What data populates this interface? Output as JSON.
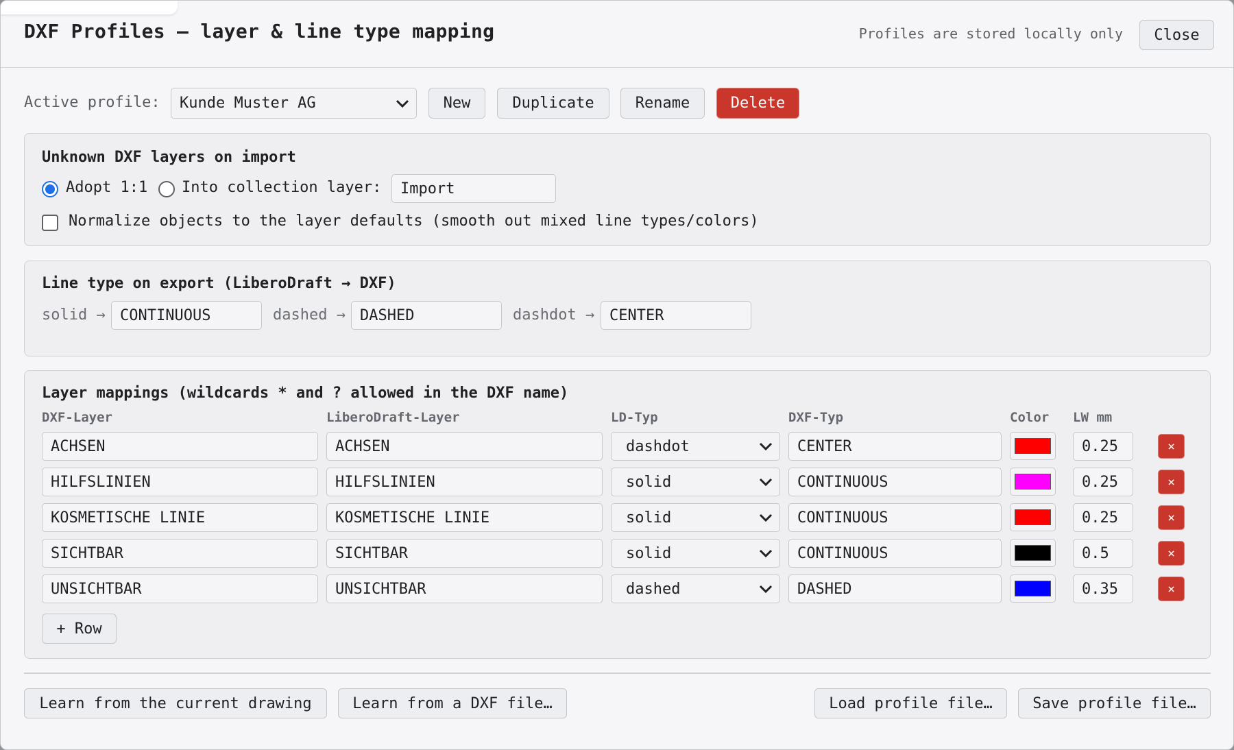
{
  "dialog": {
    "title": "DXF Profiles — layer & line type mapping",
    "note": "Profiles are stored locally only",
    "close_label": "Close"
  },
  "profile": {
    "label": "Active profile:",
    "selected": "Kunde Muster AG",
    "new_label": "New",
    "duplicate_label": "Duplicate",
    "rename_label": "Rename",
    "delete_label": "Delete"
  },
  "import": {
    "title": "Unknown DXF layers on import",
    "adopt_label": "Adopt 1:1",
    "adopt_selected": true,
    "collection_label": "Into collection layer:",
    "collection_value": "Import",
    "normalize_label": "Normalize objects to the layer defaults (smooth out mixed line types/colors)",
    "normalize_checked": false
  },
  "export": {
    "title": "Line type on export (LiberoDraft → DXF)",
    "solid_label": "solid →",
    "solid_value": "CONTINUOUS",
    "dashed_label": "dashed →",
    "dashed_value": "DASHED",
    "dashdot_label": "dashdot →",
    "dashdot_value": "CENTER"
  },
  "mappings": {
    "title": "Layer mappings (wildcards * and ? allowed in the DXF name)",
    "headers": {
      "dxf_layer": "DXF-Layer",
      "ld_layer": "LiberoDraft-Layer",
      "ld_type": "LD-Typ",
      "dxf_type": "DXF-Typ",
      "color": "Color",
      "lw": "LW mm"
    },
    "rows": [
      {
        "dxf_layer": "ACHSEN",
        "ld_layer": "ACHSEN",
        "ld_type": "dashdot",
        "dxf_type": "CENTER",
        "color": "#ff0000",
        "lw": "0.25",
        "remove": "×"
      },
      {
        "dxf_layer": "HILFSLINIEN",
        "ld_layer": "HILFSLINIEN",
        "ld_type": "solid",
        "dxf_type": "CONTINUOUS",
        "color": "#ff00ff",
        "lw": "0.25",
        "remove": "×"
      },
      {
        "dxf_layer": "KOSMETISCHE LINIE",
        "ld_layer": "KOSMETISCHE LINIE",
        "ld_type": "solid",
        "dxf_type": "CONTINUOUS",
        "color": "#ff0000",
        "lw": "0.25",
        "remove": "×"
      },
      {
        "dxf_layer": "SICHTBAR",
        "ld_layer": "SICHTBAR",
        "ld_type": "solid",
        "dxf_type": "CONTINUOUS",
        "color": "#000000",
        "lw": "0.5",
        "remove": "×"
      },
      {
        "dxf_layer": "UNSICHTBAR",
        "ld_layer": "UNSICHTBAR",
        "ld_type": "dashed",
        "dxf_type": "DASHED",
        "color": "#0000ff",
        "lw": "0.35",
        "remove": "×"
      }
    ],
    "add_row_label": "+ Row"
  },
  "footer": {
    "learn_current_label": "Learn from the current drawing",
    "learn_dxf_label": "Learn from a DXF file…",
    "load_label": "Load profile file…",
    "save_label": "Save profile file…"
  },
  "icons": {
    "dropdown": "chevron-down-icon",
    "remove": "close-icon"
  },
  "colors": {
    "danger": "#c9372c",
    "accent": "#1e6fe8"
  }
}
